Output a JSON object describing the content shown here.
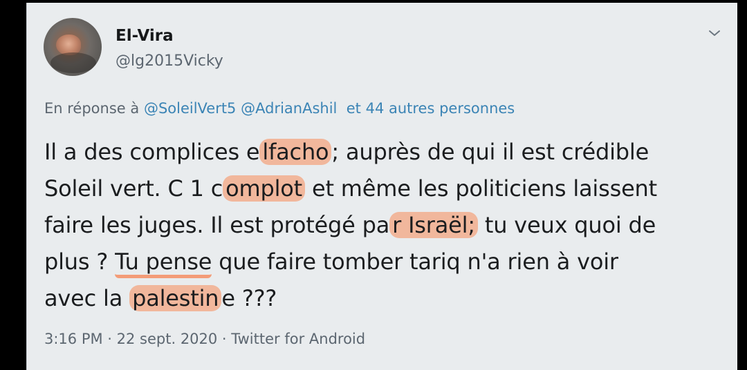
{
  "tweet": {
    "display_name": "El-Vira",
    "handle": "@lg2015Vicky",
    "reply_prefix": "En réponse à",
    "reply_mention_1": "@SoleilVert5",
    "reply_mention_2": "@AdrianAshil",
    "reply_others": "et 44 autres personnes",
    "lines": [
      {
        "before": "Il a des complices e",
        "hl": "lfacho",
        "after": "; auprès de qui il est crédible"
      },
      {
        "before": "Soleil vert. C 1 c",
        "hl": "omplot",
        "after": " et même les politiciens laissent"
      },
      {
        "before": "faire les juges. Il est protégé pa",
        "hl": "r Israël;",
        "after": " tu veux quoi de"
      },
      {
        "before": "plus ? ",
        "ul": "Tu pense",
        "after": " que faire tomber tariq n'a rien à voir"
      },
      {
        "before": "avec la ",
        "hl": "palestin",
        "after": "e ???"
      }
    ],
    "timestamp": "3:16 PM · 22 sept. 2020 · Twitter for Android",
    "menu_icon": "chevron-down-icon",
    "highlight_color": "#f78c5a"
  }
}
